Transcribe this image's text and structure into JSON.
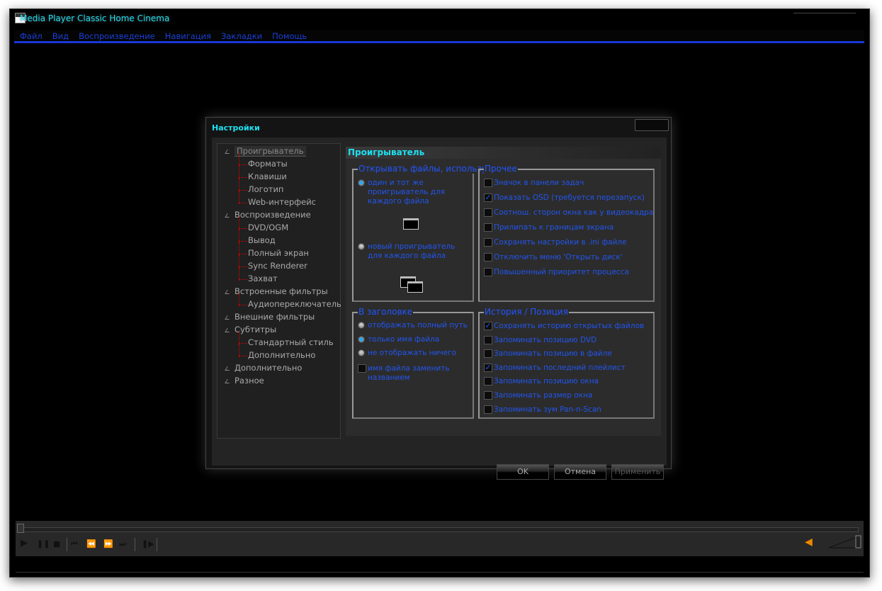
{
  "app": {
    "title": "Media Player Classic Home Cinema"
  },
  "menu": [
    "Файл",
    "Вид",
    "Воспроизведение",
    "Навигация",
    "Закладки",
    "Помощь"
  ],
  "dialog": {
    "title": "Настройки",
    "tree": [
      {
        "label": "Проигрыватель",
        "level": 0,
        "selected": true
      },
      {
        "label": "Форматы",
        "level": 1
      },
      {
        "label": "Клавиши",
        "level": 1
      },
      {
        "label": "Логотип",
        "level": 1
      },
      {
        "label": "Web-интерфейс",
        "level": 1
      },
      {
        "label": "Воспроизведение",
        "level": 0
      },
      {
        "label": "DVD/OGM",
        "level": 1
      },
      {
        "label": "Вывод",
        "level": 1
      },
      {
        "label": "Полный экран",
        "level": 1
      },
      {
        "label": "Sync Renderer",
        "level": 1
      },
      {
        "label": "Захват",
        "level": 1
      },
      {
        "label": "Встроенные фильтры",
        "level": 0
      },
      {
        "label": "Аудиопереключатель",
        "level": 1
      },
      {
        "label": "Внешние фильтры",
        "level": 0
      },
      {
        "label": "Субтитры",
        "level": 0
      },
      {
        "label": "Стандартный стиль",
        "level": 1
      },
      {
        "label": "Дополнительно",
        "level": 1
      },
      {
        "label": "Дополнительно",
        "level": 0
      },
      {
        "label": "Разное",
        "level": 0
      }
    ],
    "page_title": "Проигрыватель",
    "open_group": {
      "label": "Открывать файлы, использу",
      "options": [
        {
          "label": "один и тот же проигрыватель для каждого файла",
          "selected": true
        },
        {
          "label": "новый проигрыватель для каждого файла",
          "selected": false
        }
      ]
    },
    "other_group": {
      "label": "Прочее",
      "options": [
        {
          "label": "Значок в панели задач",
          "checked": false
        },
        {
          "label": "Показать OSD (требуется перезапуск)",
          "checked": true
        },
        {
          "label": "Соотнош. сторон окна как у видеокадра",
          "checked": false
        },
        {
          "label": "Прилипать к границам экрана",
          "checked": false
        },
        {
          "label": "Сохранять настройки в .ini файле",
          "checked": false
        },
        {
          "label": "Отключить меню 'Открыть диск'",
          "checked": false
        },
        {
          "label": "Повышенный приоритет процесса",
          "checked": false
        }
      ]
    },
    "title_group": {
      "label": "В заголовке",
      "options": [
        {
          "label": "отображать полный путь",
          "selected": false
        },
        {
          "label": "только имя файла",
          "selected": true
        },
        {
          "label": "не отображать ничего",
          "selected": false
        }
      ],
      "checkbox": {
        "label": "имя файла заменить названием",
        "checked": false
      }
    },
    "history_group": {
      "label": "История / Позиция",
      "options": [
        {
          "label": "Сохранять историю открытых файлов",
          "checked": true
        },
        {
          "label": "Запоминать позицию DVD",
          "checked": false
        },
        {
          "label": "Запоминать позицию в файле",
          "checked": false
        },
        {
          "label": "Запоминать последний плейлист",
          "checked": true
        },
        {
          "label": "Запоминать позицию окна",
          "checked": false
        },
        {
          "label": "Запоминать размер окна",
          "checked": false
        },
        {
          "label": "Запоминать зум Pan-n-Scan",
          "checked": false
        }
      ]
    },
    "buttons": {
      "ok": "OK",
      "cancel": "Отмена",
      "apply": "Применить"
    }
  },
  "controls": {
    "icons": [
      "play-icon",
      "pause-icon",
      "stop-icon",
      "prev-icon",
      "rewind-icon",
      "forward-icon",
      "next-icon",
      "frame-step-icon"
    ],
    "seek_position": 0,
    "volume": 1.0
  },
  "colors": {
    "accent": "#1ee0f0",
    "option_text": "#2255ee",
    "menu_text": "#1a3fd8"
  }
}
